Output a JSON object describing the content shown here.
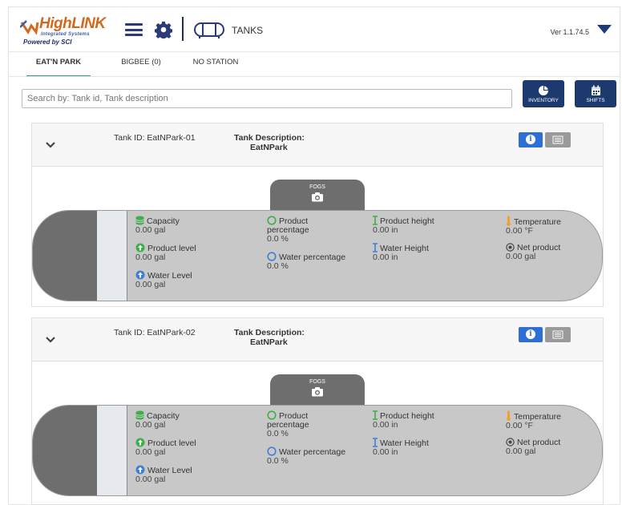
{
  "header": {
    "logo_text": "HighLINK",
    "logo_subtitle": "Integrated Systems",
    "logo_powered": "Powered by SCI",
    "title": "TANKS",
    "version": "Ver 1.1.74.5"
  },
  "tabs": [
    {
      "label": "EAT'N PARK",
      "active": true
    },
    {
      "label": "BIGBEE (0)",
      "active": false
    },
    {
      "label": "NO STATION",
      "active": false
    }
  ],
  "search": {
    "placeholder": "Search by: Tank id, Tank description"
  },
  "actions": {
    "inventory_label": "INVENTORY",
    "shifts_label": "SHIFTS"
  },
  "colors": {
    "accent_tab": "#2e9b8c",
    "button_dark": "#1d3a6e",
    "info_blue": "#2e6fd6"
  },
  "tanks": [
    {
      "id_label": "Tank ID: EatNPark-01",
      "desc_label": "Tank Description:",
      "desc_value": "EatNPark",
      "fogs_label": "FOGS",
      "metrics": {
        "capacity_label": "Capacity",
        "capacity_value": "0.00 gal",
        "product_level_label": "Product level",
        "product_level_value": "0.00 gal",
        "water_level_label": "Water Level",
        "water_level_value": "0.00 gal",
        "product_pct_label": "Product",
        "product_pct_label2": "percentage",
        "product_pct_value": "0.0 %",
        "water_pct_label": "Water percentage",
        "water_pct_value": "0.0 %",
        "product_height_label": "Product height",
        "product_height_value": "0.00 in",
        "water_height_label": "Water Height",
        "water_height_value": "0.00 in",
        "temperature_label": "Temperature",
        "temperature_value": "0.00 °F",
        "net_product_label": "Net product",
        "net_product_value": "0.00 gal"
      }
    },
    {
      "id_label": "Tank ID: EatNPark-02",
      "desc_label": "Tank Description:",
      "desc_value": "EatNPark",
      "fogs_label": "FOGS",
      "metrics": {
        "capacity_label": "Capacity",
        "capacity_value": "0.00 gal",
        "product_level_label": "Product level",
        "product_level_value": "0.00 gal",
        "water_level_label": "Water Level",
        "water_level_value": "0.00 gal",
        "product_pct_label": "Product",
        "product_pct_label2": "percentage",
        "product_pct_value": "0.0 %",
        "water_pct_label": "Water percentage",
        "water_pct_value": "0.0 %",
        "product_height_label": "Product height",
        "product_height_value": "0.00 in",
        "water_height_label": "Water Height",
        "water_height_value": "0.00 in",
        "temperature_label": "Temperature",
        "temperature_value": "0.00 °F",
        "net_product_label": "Net product",
        "net_product_value": "0.00 gal"
      }
    }
  ]
}
